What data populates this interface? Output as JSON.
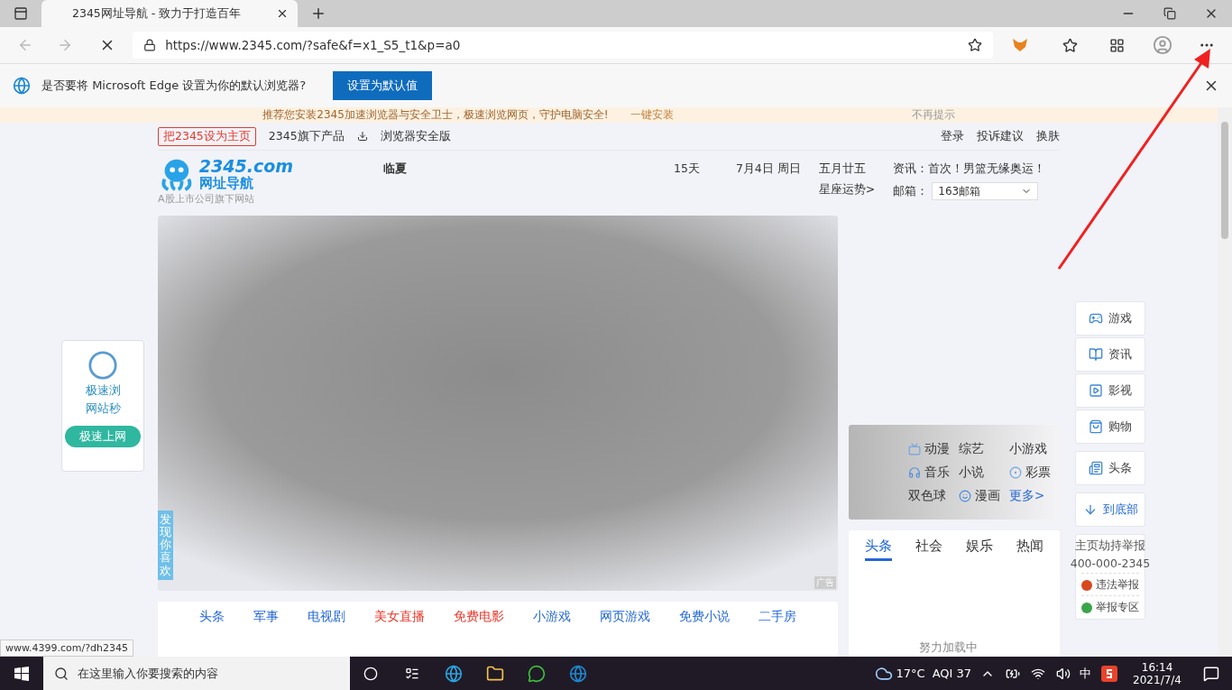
{
  "browser": {
    "tab_title": "2345网址导航 - 致力于打造百年",
    "url": "https://www.2345.com/?safe&f=x1_S5_t1&p=a0"
  },
  "infobar": {
    "message": "是否要将 Microsoft Edge 设置为你的默认浏览器?",
    "button": "设置为默认值"
  },
  "promo_banner": {
    "message": "推荐您安装2345加速浏览器与安全卫士，极速浏览网页，守护电脑安全!",
    "install": "一键安装",
    "dismiss": "不再提示"
  },
  "top_links": {
    "homepage": "把2345设为主页",
    "products": "2345旗下产品",
    "safe_version": "浏览器安全版",
    "login": "登录",
    "feedback": "投诉建议",
    "skin": "换肤"
  },
  "header": {
    "logo_text": "2345.com",
    "logo_sub": "网址导航",
    "tagline": "A股上市公司旗下网站",
    "city": "临夏",
    "forecast": "15天",
    "date": "7月4日 周日",
    "lunar": "五月廿五",
    "horoscope": "星座运势>",
    "news": "资讯：首次！男篮无缘奥运！",
    "mail_label": "邮箱：",
    "mail_value": "163邮箱"
  },
  "side_card": {
    "lines": [
      "极速浏",
      "网站秒"
    ],
    "button": "极速上网"
  },
  "ad": {
    "discover": "发现你喜欢",
    "label": "广告"
  },
  "quick_links": [
    {
      "label": "动漫",
      "kind": "tv"
    },
    {
      "label": "综艺",
      "kind": "plain"
    },
    {
      "label": "小游戏",
      "kind": "plain"
    },
    {
      "label": "音乐",
      "kind": "music"
    },
    {
      "label": "小说",
      "kind": "plain"
    },
    {
      "label": "彩票",
      "kind": "lottery"
    },
    {
      "label": "双色球",
      "kind": "plain"
    },
    {
      "label": "漫画",
      "kind": "comic"
    },
    {
      "label": "更多>",
      "kind": "more"
    }
  ],
  "side_nav": [
    {
      "label": "游戏",
      "kind": "game"
    },
    {
      "label": "资讯",
      "kind": "book"
    },
    {
      "label": "影视",
      "kind": "video"
    },
    {
      "label": "购物",
      "kind": "bag"
    },
    {
      "label": "头条",
      "kind": "news"
    },
    {
      "label": "到底部",
      "kind": "down"
    }
  ],
  "report": {
    "title": "主页劫持举报",
    "phone": "400-000-2345",
    "items": [
      {
        "label": "违法举报",
        "color": "#d8481f"
      },
      {
        "label": "举报专区",
        "color": "#3aa54a"
      }
    ]
  },
  "news_card": {
    "tabs": [
      {
        "label": "头条",
        "selected": true
      },
      {
        "label": "社会",
        "selected": false
      },
      {
        "label": "娱乐",
        "selected": false
      },
      {
        "label": "热闻",
        "selected": false
      }
    ],
    "loading": "努力加载中"
  },
  "nav_links": [
    {
      "label": "头条",
      "color": "#2468d6"
    },
    {
      "label": "军事",
      "color": "#2468d6"
    },
    {
      "label": "电视剧",
      "color": "#2468d6"
    },
    {
      "label": "美女直播",
      "color": "#e8382b"
    },
    {
      "label": "免费电影",
      "color": "#e8382b"
    },
    {
      "label": "小游戏",
      "color": "#2468d6"
    },
    {
      "label": "网页游戏",
      "color": "#2468d6"
    },
    {
      "label": "免费小说",
      "color": "#2468d6"
    },
    {
      "label": "二手房",
      "color": "#2468d6"
    }
  ],
  "status_url": "www.4399.com/?dh2345",
  "taskbar": {
    "search_placeholder": "在这里输入你要搜索的内容",
    "temperature": "17°C",
    "aqi": "AQI 37",
    "ime": "中",
    "time": "16:14",
    "date": "2021/7/4"
  }
}
